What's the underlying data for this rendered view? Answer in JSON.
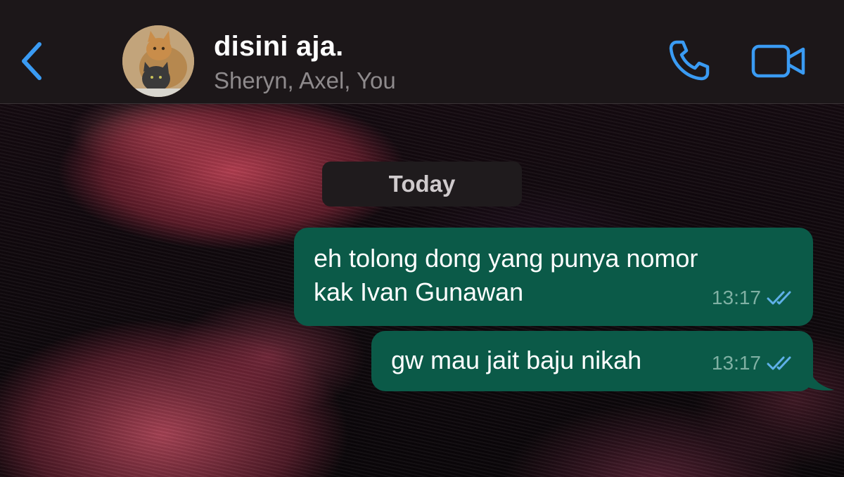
{
  "header": {
    "title": "disini aja.",
    "participants": "Sheryn, Axel, You",
    "back_icon": "chevron-left-icon",
    "call_icon": "phone-icon",
    "video_icon": "video-camera-icon"
  },
  "chat": {
    "date_label": "Today",
    "messages": [
      {
        "lines": [
          "eh tolong dong yang punya nomor",
          "kak Ivan Gunawan"
        ],
        "time": "13:17",
        "status": "read"
      },
      {
        "lines": [
          "gw mau jait baju nikah"
        ],
        "time": "13:17",
        "status": "read"
      }
    ]
  },
  "colors": {
    "accent": "#3a9bf3",
    "outgoing_bubble": "#0b5a48",
    "header_bg": "#1c1719",
    "read_ticks": "#5fb0e8"
  }
}
